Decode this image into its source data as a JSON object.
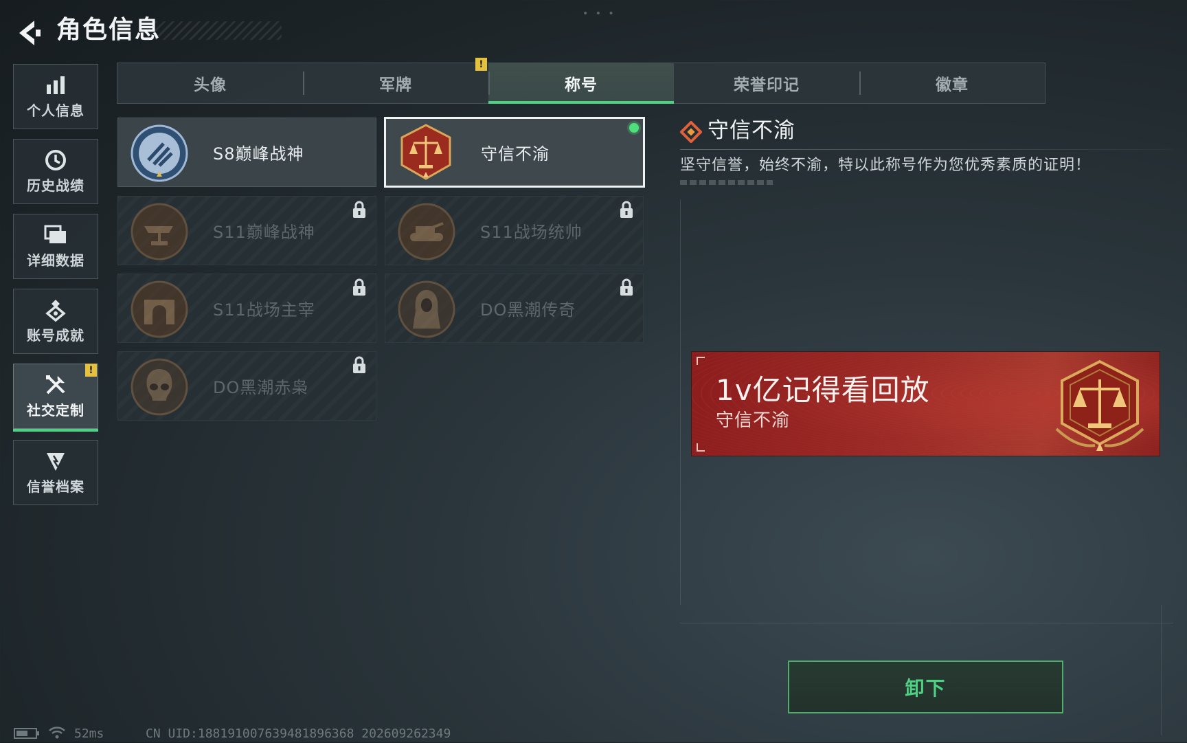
{
  "header": {
    "title": "角色信息"
  },
  "sidebar": {
    "items": [
      {
        "label": "个人信息",
        "icon": "bar-chart-icon",
        "active": false
      },
      {
        "label": "历史战绩",
        "icon": "clock-icon",
        "active": false
      },
      {
        "label": "详细数据",
        "icon": "folder-icon",
        "active": false
      },
      {
        "label": "账号成就",
        "icon": "achievement-icon",
        "active": false
      },
      {
        "label": "社交定制",
        "icon": "tools-icon",
        "active": true,
        "badge": "!"
      },
      {
        "label": "信誉档案",
        "icon": "shield-icon",
        "active": false
      }
    ]
  },
  "tabs": [
    {
      "label": "头像",
      "active": false
    },
    {
      "label": "军牌",
      "active": false,
      "badge": "!"
    },
    {
      "label": "称号",
      "active": true
    },
    {
      "label": "荣誉印记",
      "active": false
    },
    {
      "label": "徽章",
      "active": false
    }
  ],
  "titles": [
    {
      "name": "S8巅峰战神",
      "state": "owned",
      "icon": "s8-peak-medal-icon"
    },
    {
      "name": "守信不渝",
      "state": "selected",
      "equipped": true,
      "icon": "justice-scale-medal-icon"
    },
    {
      "name": "S11巅峰战神",
      "state": "locked",
      "icon": "anvil-medal-icon"
    },
    {
      "name": "S11战场统帅",
      "state": "locked",
      "icon": "tank-medal-icon"
    },
    {
      "name": "S11战场主宰",
      "state": "locked",
      "icon": "arch-medal-icon"
    },
    {
      "name": "DO黑潮传奇",
      "state": "locked",
      "icon": "hooded-figure-medal-icon"
    },
    {
      "name": "DO黑潮赤枭",
      "state": "locked",
      "icon": "skull-medal-icon"
    }
  ],
  "detail": {
    "title": "守信不渝",
    "description": "坚守信誉，始终不渝，特以此称号作为您优秀素质的证明！"
  },
  "banner": {
    "player_name": "1v亿记得看回放",
    "title_name": "守信不渝"
  },
  "actions": {
    "unequip_label": "卸下"
  },
  "status_bar": {
    "ping": "52ms",
    "uid_text": "CN UID:1881910076394818963​68 202609262349"
  },
  "colors": {
    "accent_green": "#4fd183",
    "banner_red": "#9c2a26",
    "warning_yellow": "#e6c13c"
  }
}
